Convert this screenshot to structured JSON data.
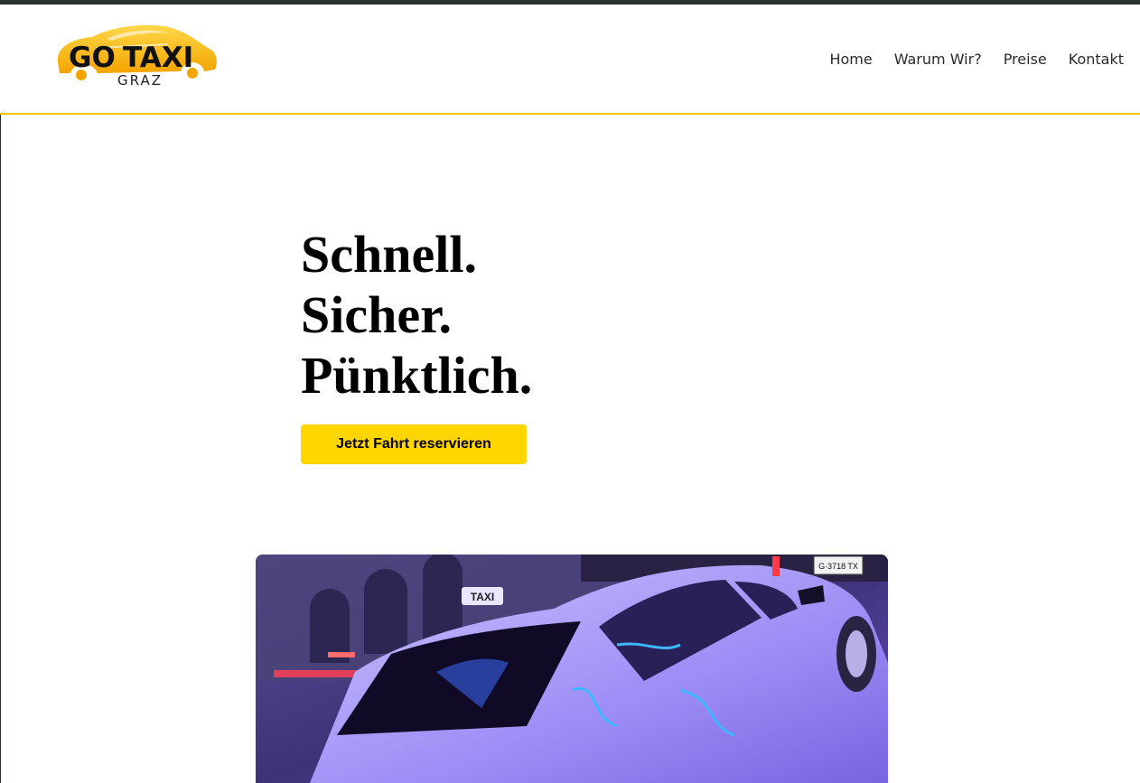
{
  "brand": {
    "logo_word_1": "GO",
    "logo_word_2": "TAXI",
    "logo_subtitle": "GRAZ",
    "accent_color": "#ffd600",
    "header_border_color": "#f6c400"
  },
  "nav": {
    "items": [
      {
        "label": "Home"
      },
      {
        "label": "Warum Wir?"
      },
      {
        "label": "Preise"
      },
      {
        "label": "Kontakt"
      }
    ]
  },
  "hero": {
    "headline_lines": [
      "Schnell.",
      "Sicher.",
      "Pünktlich."
    ],
    "cta_label": "Jetzt Fahrt reservieren"
  },
  "photo": {
    "taxi_sign": "TAXI",
    "plate": "G·3718 TX"
  }
}
